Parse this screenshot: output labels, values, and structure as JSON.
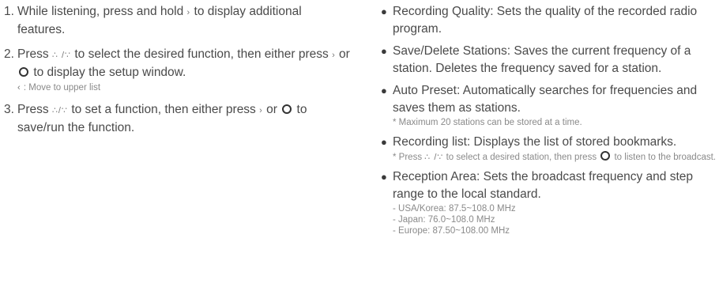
{
  "steps": [
    {
      "num": "1.",
      "t1": "While listening, press and hold ",
      "icon1": "›",
      "t2": "to display additional features."
    },
    {
      "num": "2.",
      "t1": "Press ",
      "icon1": "∴ /∵",
      "t2": " to select the desired function, then either press ",
      "icon2": "›",
      "t3": " or ",
      "t4": " to display the setup window.",
      "sub_icon": "‹",
      "sub": " : Move to upper list"
    },
    {
      "num": "3.",
      "t1": "Press ",
      "icon1": "∴/∵",
      "t2": " to set a function, then either press ",
      "icon2": "›",
      "t3": " or ",
      "t4": " to save/run the function."
    }
  ],
  "bullets": [
    {
      "text": "Recording Quality: Sets the quality of the recorded radio program."
    },
    {
      "text": "Save/Delete Stations: Saves the current frequency of a station. Deletes the  frequency saved for a station."
    },
    {
      "text": "Auto Preset: Automatically searches for frequencies and saves them as stations.",
      "note": "* Maximum 20 stations can be stored at a time."
    },
    {
      "text": "Recording list: Displays the list of stored bookmarks.",
      "note_t1": "* Press ",
      "note_icon": "∴ /∵",
      "note_t2": " to select a desired station, then press ",
      "note_t3": " to listen to the broadcast."
    },
    {
      "text": "Reception Area: Sets the broadcast frequency and step range to the local standard.",
      "regions": [
        "- USA/Korea: 87.5~108.0 MHz",
        "- Japan: 76.0~108.0 MHz",
        "- Europe: 87.50~108.00 MHz"
      ]
    }
  ],
  "icons": {
    "next": "chevron-right-icon",
    "back": "chevron-left-icon",
    "updown": "up-down-icon",
    "ok": "circle-button-icon"
  }
}
